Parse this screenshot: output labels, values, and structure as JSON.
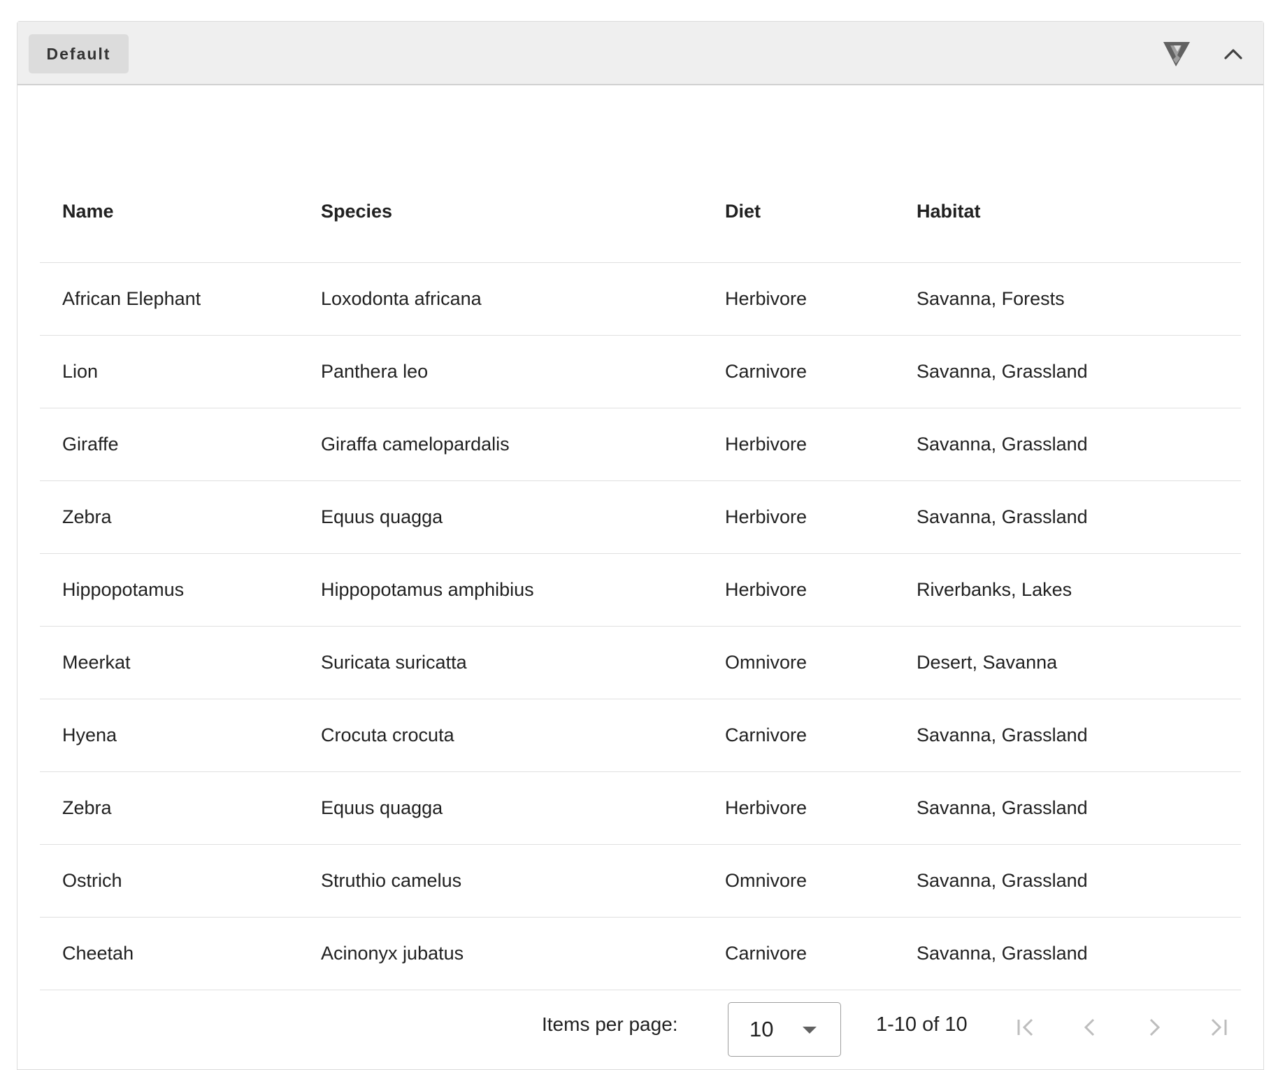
{
  "panel": {
    "tab_label": "Default",
    "icons": [
      "brand-logo-icon",
      "chevron-up-icon"
    ]
  },
  "table": {
    "headers": {
      "name": "Name",
      "species": "Species",
      "diet": "Diet",
      "habitat": "Habitat"
    },
    "rows": [
      {
        "name": "African Elephant",
        "species": "Loxodonta africana",
        "diet": "Herbivore",
        "habitat": "Savanna, Forests"
      },
      {
        "name": "Lion",
        "species": "Panthera leo",
        "diet": "Carnivore",
        "habitat": "Savanna, Grassland"
      },
      {
        "name": "Giraffe",
        "species": "Giraffa camelopardalis",
        "diet": "Herbivore",
        "habitat": "Savanna, Grassland"
      },
      {
        "name": "Zebra",
        "species": "Equus quagga",
        "diet": "Herbivore",
        "habitat": "Savanna, Grassland"
      },
      {
        "name": "Hippopotamus",
        "species": "Hippopotamus amphibius",
        "diet": "Herbivore",
        "habitat": "Riverbanks, Lakes"
      },
      {
        "name": "Meerkat",
        "species": "Suricata suricatta",
        "diet": "Omnivore",
        "habitat": "Desert, Savanna"
      },
      {
        "name": "Hyena",
        "species": "Crocuta crocuta",
        "diet": "Carnivore",
        "habitat": "Savanna, Grassland"
      },
      {
        "name": "Zebra",
        "species": "Equus quagga",
        "diet": "Herbivore",
        "habitat": "Savanna, Grassland"
      },
      {
        "name": "Ostrich",
        "species": "Struthio camelus",
        "diet": "Omnivore",
        "habitat": "Savanna, Grassland"
      },
      {
        "name": "Cheetah",
        "species": "Acinonyx jubatus",
        "diet": "Carnivore",
        "habitat": "Savanna, Grassland"
      }
    ]
  },
  "paginator": {
    "items_per_page_label": "Items per page:",
    "page_size": "10",
    "range_label": "1-10 of 10",
    "icons": [
      "first-page-icon",
      "previous-page-icon",
      "next-page-icon",
      "last-page-icon"
    ]
  }
}
